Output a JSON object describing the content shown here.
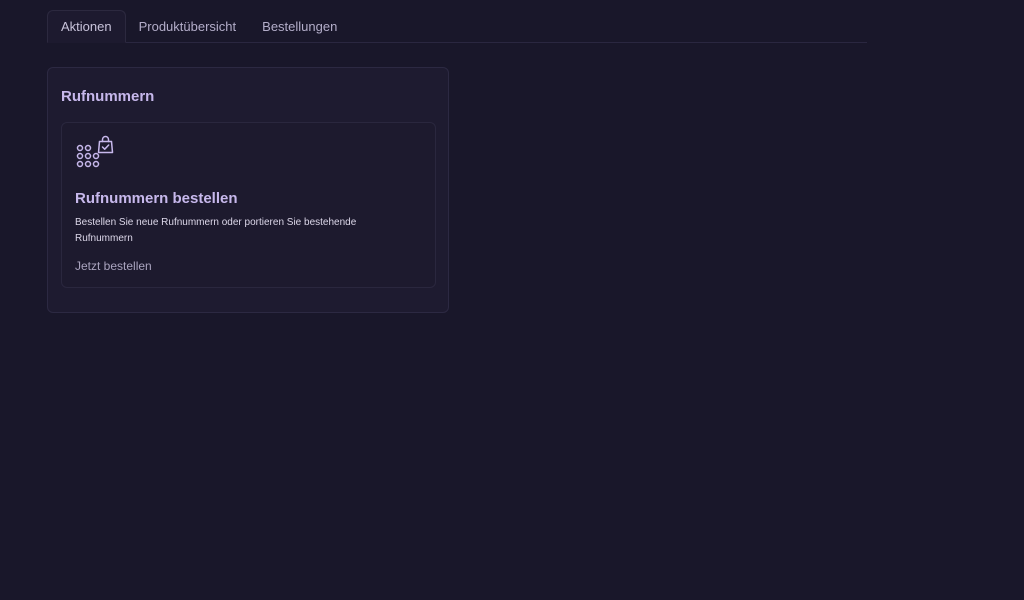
{
  "tabs": [
    {
      "label": "Aktionen",
      "active": true
    },
    {
      "label": "Produktübersicht",
      "active": false
    },
    {
      "label": "Bestellungen",
      "active": false
    }
  ],
  "panel": {
    "title": "Rufnummern",
    "card": {
      "icon": "keypad-shopping-bag-icon",
      "title": "Rufnummern bestellen",
      "description": "Bestellen Sie neue Rufnummern oder portieren Sie bestehende Rufnummern",
      "link_label": "Jetzt bestellen"
    }
  },
  "colors": {
    "background": "#19172a",
    "accent": "#c7b8ec",
    "panel": "#1e1b30"
  }
}
